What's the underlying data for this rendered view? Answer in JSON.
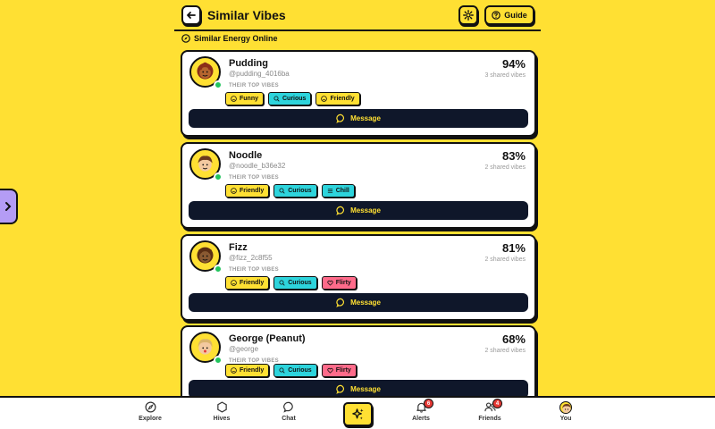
{
  "header": {
    "title": "Similar Vibes",
    "guide_label": "Guide"
  },
  "section": {
    "label": "Similar Energy Online"
  },
  "vibes_label": "THEIR TOP VIBES",
  "message_label": "Message",
  "cards": [
    {
      "name": "Pudding",
      "handle": "@pudding_4016ba",
      "match": "94%",
      "shared": "3 shared vibes",
      "vibes": [
        {
          "label": "Funny",
          "color": "#FFE033",
          "icon": "smile-icon"
        },
        {
          "label": "Curious",
          "color": "#2DD4DC",
          "icon": "search-icon"
        },
        {
          "label": "Friendly",
          "color": "#FFE033",
          "icon": "smile-icon"
        }
      ]
    },
    {
      "name": "Noodle",
      "handle": "@noodle_b36e32",
      "match": "83%",
      "shared": "2 shared vibes",
      "vibes": [
        {
          "label": "Friendly",
          "color": "#FFE033",
          "icon": "smile-icon"
        },
        {
          "label": "Curious",
          "color": "#2DD4DC",
          "icon": "search-icon"
        },
        {
          "label": "Chill",
          "color": "#2DD4DC",
          "icon": "list-icon"
        }
      ]
    },
    {
      "name": "Fizz",
      "handle": "@fizz_2c8f55",
      "match": "81%",
      "shared": "2 shared vibes",
      "vibes": [
        {
          "label": "Friendly",
          "color": "#FFE033",
          "icon": "smile-icon"
        },
        {
          "label": "Curious",
          "color": "#2DD4DC",
          "icon": "search-icon"
        },
        {
          "label": "Flirty",
          "color": "#FF6B8A",
          "icon": "heart-icon"
        }
      ]
    },
    {
      "name": "George (Peanut)",
      "handle": "@george",
      "match": "68%",
      "shared": "2 shared vibes",
      "vibes": [
        {
          "label": "Friendly",
          "color": "#FFE033",
          "icon": "smile-icon"
        },
        {
          "label": "Curious",
          "color": "#2DD4DC",
          "icon": "search-icon"
        },
        {
          "label": "Flirty",
          "color": "#FF6B8A",
          "icon": "heart-icon"
        }
      ]
    }
  ],
  "nav": {
    "items": [
      {
        "label": "Explore",
        "icon": "compass-icon"
      },
      {
        "label": "Hives",
        "icon": "hexagon-icon"
      },
      {
        "label": "Chat",
        "icon": "chat-icon"
      },
      {
        "label": "Alerts",
        "icon": "bell-icon",
        "badge": "6"
      },
      {
        "label": "Friends",
        "icon": "friends-icon",
        "badge": "4"
      },
      {
        "label": "You",
        "icon": "avatar"
      }
    ],
    "center_icon": "sparkle-icon"
  },
  "colors": {
    "background": "#FFE033",
    "card": "#FFFFFF",
    "message_button": "#0F172A",
    "online": "#22C55E",
    "badge": "#E53935"
  }
}
